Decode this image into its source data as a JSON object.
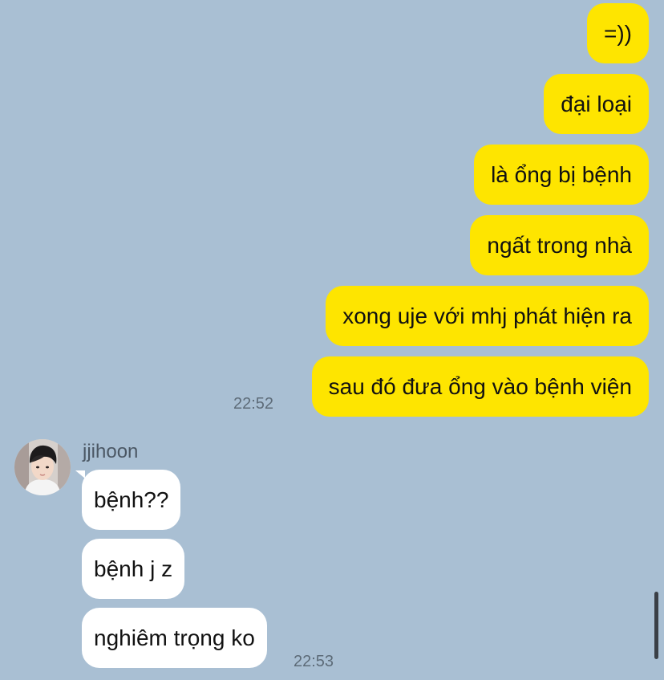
{
  "outgoing_messages": [
    {
      "text": "=))"
    },
    {
      "text": "đại loại"
    },
    {
      "text": "là ổng bị bệnh"
    },
    {
      "text": "ngất trong nhà"
    },
    {
      "text": "xong uje với mhj phát hiện ra"
    },
    {
      "text": "sau đó đưa ổng vào bệnh viện"
    }
  ],
  "outgoing_time": "22:52",
  "incoming": {
    "sender_name": "jjihoon",
    "messages": [
      {
        "text": "bệnh??"
      },
      {
        "text": "bệnh j z"
      },
      {
        "text": "nghiêm trọng ko"
      }
    ],
    "time": "22:53"
  },
  "colors": {
    "background": "#a9bfd3",
    "outgoing_bubble": "#fee500",
    "incoming_bubble": "#ffffff"
  }
}
